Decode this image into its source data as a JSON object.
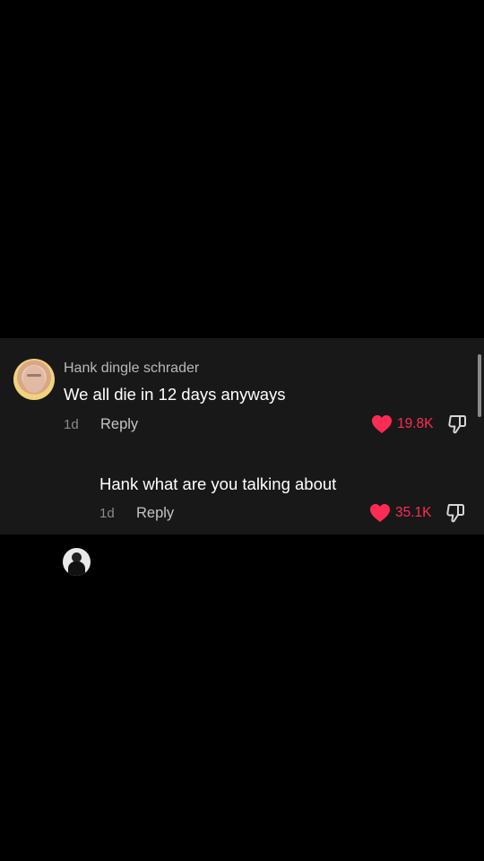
{
  "comments": [
    {
      "username": "Hank dingle schrader",
      "text": "We all die in 12 days anyways",
      "time": "1d",
      "reply_label": "Reply",
      "likes": "19.8K",
      "liked": true
    },
    {
      "username": "",
      "text": "Hank what are you talking about",
      "time": "1d",
      "reply_label": "Reply",
      "likes": "35.1K",
      "liked": true
    }
  ],
  "colors": {
    "background": "#000000",
    "panel": "#181818",
    "like_active": "#fe2c55",
    "text_primary": "#ffffff",
    "text_secondary": "#8b8b8b"
  },
  "icons": {
    "like": "heart-icon",
    "dislike": "thumbs-down-icon"
  }
}
